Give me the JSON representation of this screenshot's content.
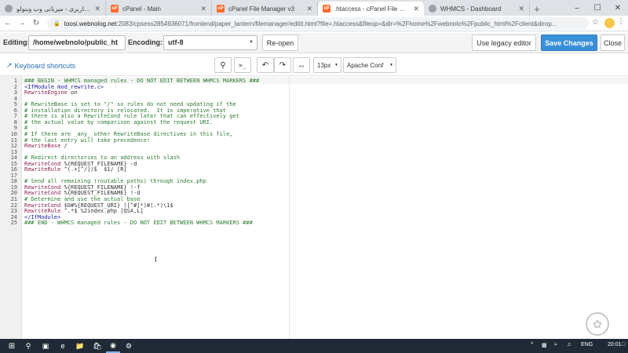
{
  "browser": {
    "tabs": [
      {
        "title": "ناحیه کاربری - میزبانی وب وبنولو",
        "favicon": "globe-icon",
        "active": false
      },
      {
        "title": "cPanel - Main",
        "favicon": "cpanel-icon",
        "active": false
      },
      {
        "title": "cPanel File Manager v3",
        "favicon": "cpanel-icon",
        "active": false
      },
      {
        "title": ".htaccess - cPanel File Manage",
        "favicon": "cpanel-icon",
        "active": true
      },
      {
        "title": "WHMCS - Dashboard",
        "favicon": "globe-icon",
        "active": false
      }
    ],
    "url_host": "toosi.webnolog.net",
    "url_path": ":2083/cpsess2854936071/frontend/paper_lantern/filemanager/editit.html?file=.htaccess&fileop=&dir=%2Fhome%2Fwebnolo%2Fpublic_html%2Fclient&dirop..."
  },
  "editor_toolbar": {
    "editing_label": "Editing:",
    "path_value": "/home/webnolo/public_ht",
    "encoding_label": "Encoding:",
    "encoding_value": "utf-8",
    "reopen_label": "Re-open",
    "legacy_label": "Use legacy editor",
    "save_label": "Save Changes",
    "close_label": "Close"
  },
  "sub_toolbar": {
    "shortcuts_label": "Keyboard shortcuts",
    "font_size": "13px",
    "mode": "Apache Conf"
  },
  "code_lines": [
    "### BEGIN - WHMCS managed rules - DO NOT EDIT BETWEEN WHMCS MARKERS ###",
    "<IfModule mod_rewrite.c>",
    "RewriteEngine on",
    "",
    "# RewriteBase is set to \"/\" so rules do not need updating if the",
    "# installation directory is relocated.  It is imperative that",
    "# there is also a RewriteCond rule later that can effectively get",
    "# the actual value by comparison against the request URI.",
    "#",
    "# If there are _any_ other RewriteBase directives in this file,",
    "# the last entry will take precedence!",
    "RewriteBase /",
    "",
    "# Redirect directories to an address with slash",
    "RewriteCond %{REQUEST_FILENAME} -d",
    "RewriteRule ^(.+[^/])$  $1/ [R]",
    "",
    "# Send all remaining (routable paths) through index.php",
    "RewriteCond %{REQUEST_FILENAME} !-f",
    "RewriteCond %{REQUEST_FILENAME} !-d",
    "# Determine and use the actual base",
    "RewriteCond $0#%{REQUEST_URI} ([^#]*)#(.*)\\1$",
    "RewriteRule ^.*$ %2index.php [QSA,L]",
    "</IfModule>",
    "### END - WHMCS managed rules - DO NOT EDIT BETWEEN WHMCS MARKERS ###"
  ],
  "taskbar": {
    "language": "ENG",
    "time": "20:01"
  }
}
